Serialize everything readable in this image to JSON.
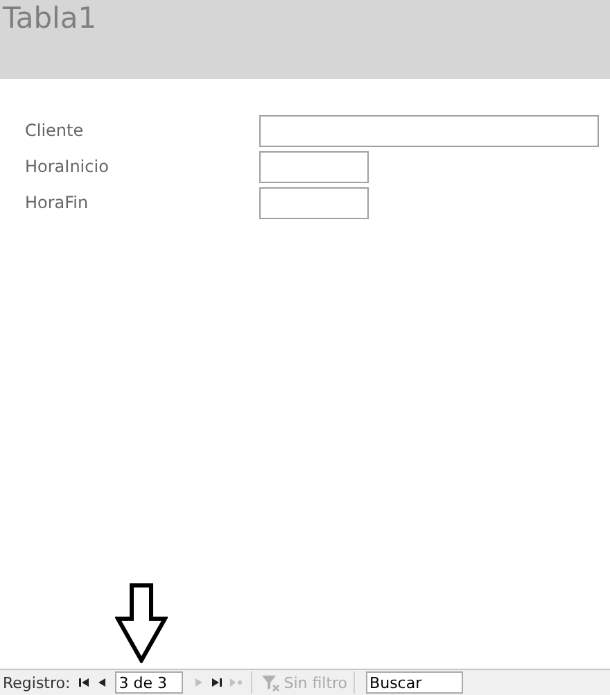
{
  "header": {
    "title": "Tabla1"
  },
  "fields": [
    {
      "label": "Cliente",
      "kind": "wide"
    },
    {
      "label": "HoraInicio",
      "kind": "short"
    },
    {
      "label": "HoraFin",
      "kind": "short"
    }
  ],
  "navigation": {
    "label": "Registro:",
    "buttons": [
      {
        "kind": "first",
        "disabled": false
      },
      {
        "kind": "previous",
        "disabled": false
      },
      {
        "kind": "current",
        "value": "3 de 3"
      },
      {
        "kind": "next",
        "disabled": true
      },
      {
        "kind": "last",
        "disabled": false
      },
      {
        "kind": "new",
        "disabled": true
      }
    ],
    "filter": {
      "label": "Sin filtro",
      "disabled": true
    },
    "search": {
      "value": "Buscar"
    }
  }
}
